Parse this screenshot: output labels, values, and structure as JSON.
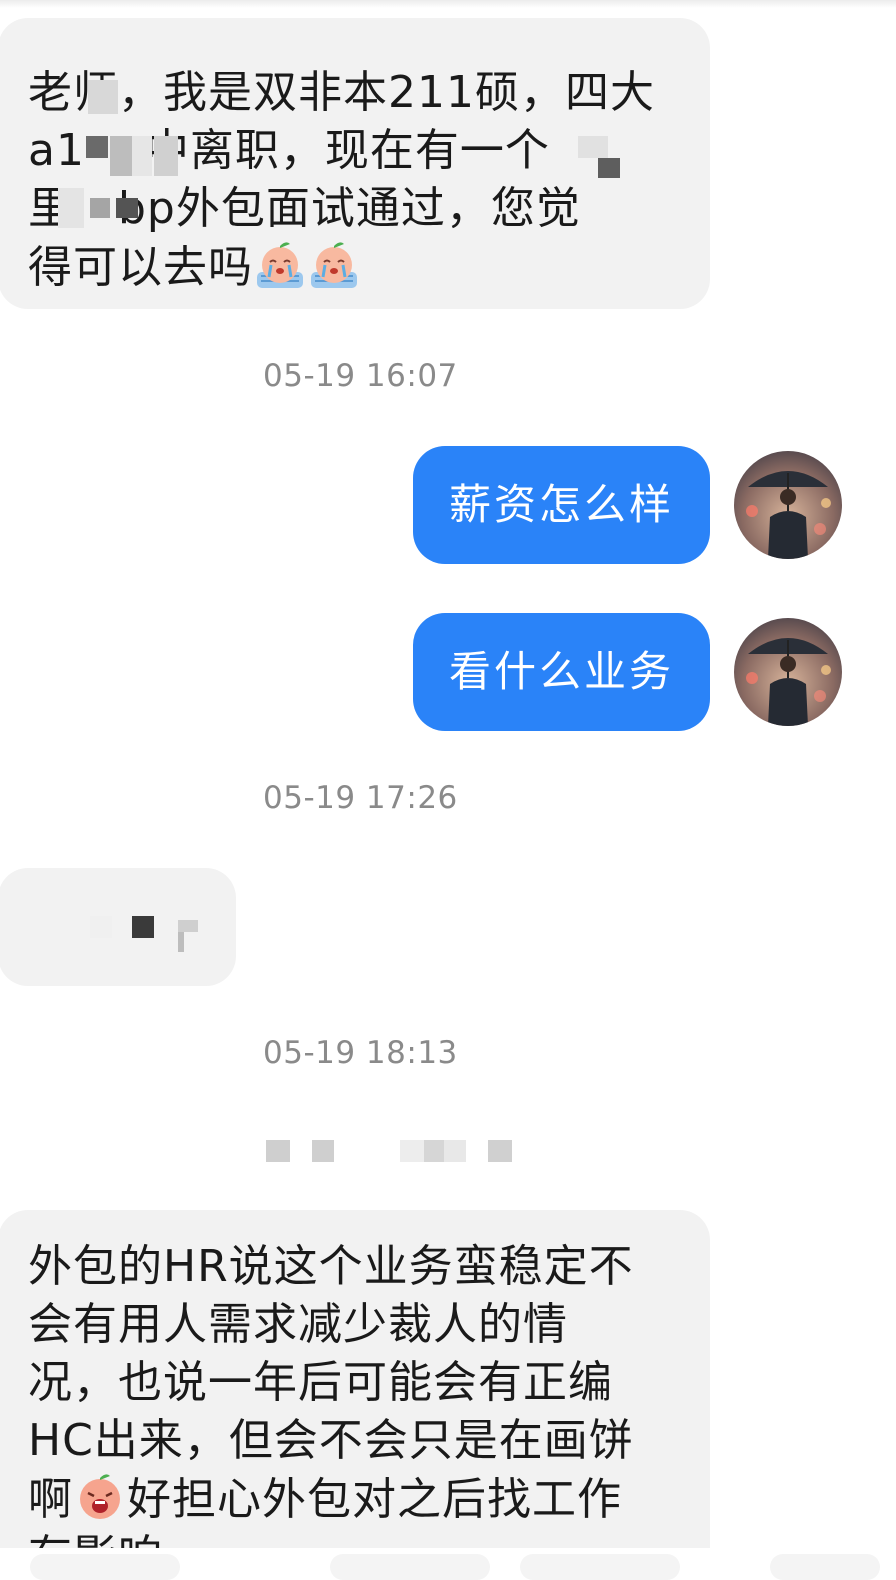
{
  "messages": [
    {
      "side": "left",
      "text": "老师，我是双非本211硕，四大a1 中离职，现在有一个 里 bp外包面试通过，您觉得可以去吗"
    },
    {
      "side": "time",
      "text": "05-19 16:07"
    },
    {
      "side": "right",
      "text": "薪资怎么样"
    },
    {
      "side": "right",
      "text": "看什么业务"
    },
    {
      "side": "time",
      "text": "05-19 17:26"
    },
    {
      "side": "left",
      "text": "(pixelated)"
    },
    {
      "side": "time",
      "text": "05-19 18:13"
    },
    {
      "side": "left",
      "text": "外包的HR说这个业务蛮稳定不会有用人需求减少裁人的情况，也说一年后可能会有正编HC出来，但会不会只是在画饼啊好担心外包对之后找工作有影响"
    }
  ],
  "msg1_lines": [
    "老师，我是双非本211硕，四大",
    "a1    中离职，现在有一个",
    "里   bp外包面试通过，您觉",
    "得可以去吗"
  ],
  "msg_last_lines": [
    "外包的HR说这个业务蛮稳定不",
    "会有用人需求减少裁人的情",
    "况，也说一年后可能会有正编",
    "HC出来，但会不会只是在画饼",
    "啊",
    "好担心外包对之后找工作",
    "有影响"
  ],
  "icons": {
    "crying_emoji": "crying-peach-emoji",
    "screaming_emoji": "screaming-peach-emoji",
    "avatar": "man-with-umbrella-avatar"
  },
  "colors": {
    "sent_bubble": "#2a83f8",
    "received_bubble": "#f2f2f2",
    "timestamp": "#8a8a8a"
  }
}
